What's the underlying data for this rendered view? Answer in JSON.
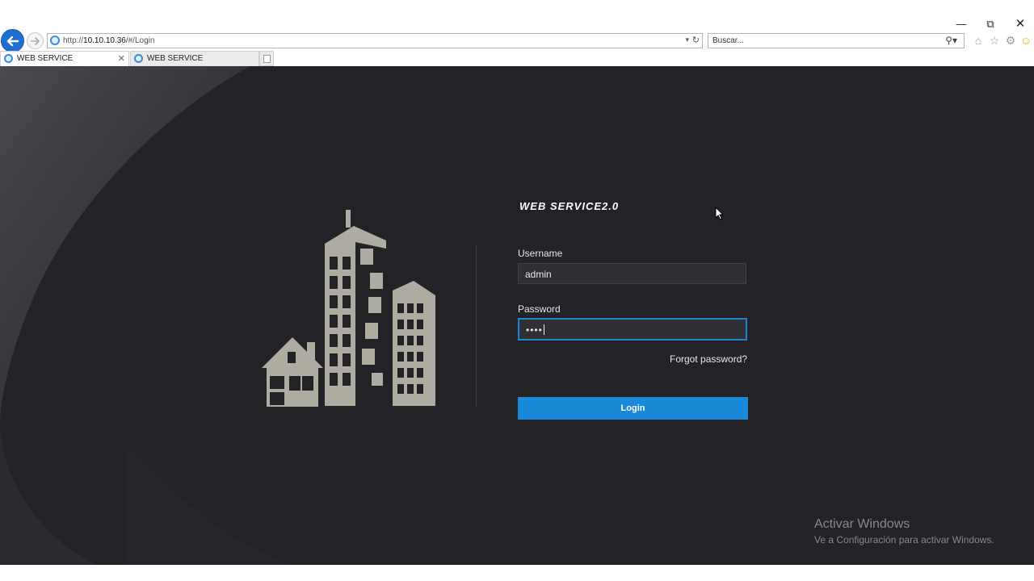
{
  "browser": {
    "url_prefix": "http://",
    "url_host": "10.10.10.36",
    "url_path": "/#/Login",
    "search_placeholder": "Buscar...",
    "tabs": [
      {
        "label": "WEB SERVICE"
      },
      {
        "label": "WEB SERVICE"
      }
    ],
    "icons": [
      "back-arrow-icon",
      "forward-arrow-icon",
      "ie-icon",
      "refresh-icon",
      "search-icon",
      "home-icon",
      "star-icon",
      "gear-icon",
      "smiley-icon"
    ]
  },
  "login": {
    "brand": "WEB SERVICE2.0",
    "username_label": "Username",
    "username_value": "admin",
    "password_label": "Password",
    "password_value": "••••",
    "forgot_label": "Forgot password?",
    "login_label": "Login"
  },
  "watermark": {
    "title": "Activar Windows",
    "subtitle": "Ve a Configuración para activar Windows."
  },
  "colors": {
    "page_bg": "#232327",
    "accent": "#1a8ad8",
    "illustration": "#aeaba0"
  }
}
